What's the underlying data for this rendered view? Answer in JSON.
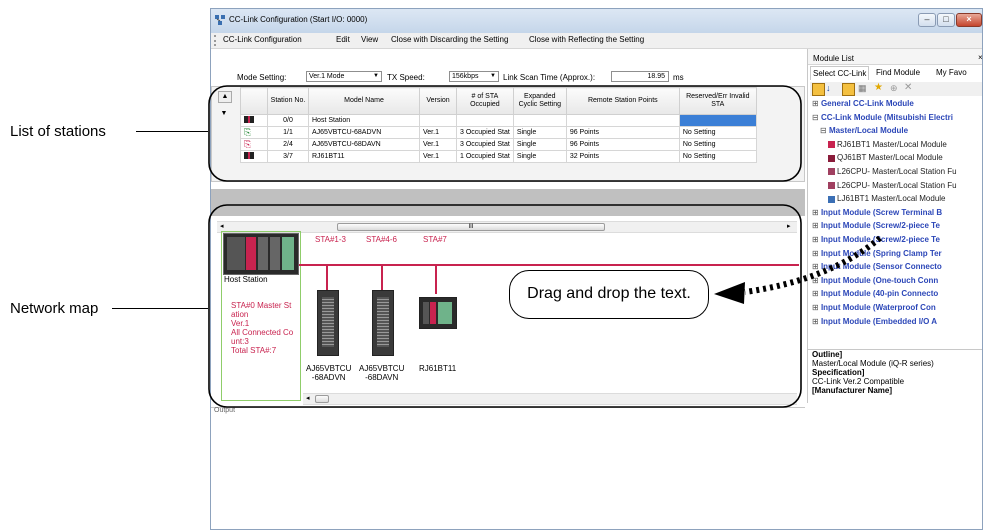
{
  "window": {
    "title": "CC-Link Configuration (Start I/O: 0000)",
    "menu": [
      "CC-Link Configuration",
      "Edit",
      "View",
      "Close with Discarding the Setting",
      "Close with Reflecting the Setting"
    ]
  },
  "settings": {
    "mode_label": "Mode Setting:",
    "mode_value": "Ver.1 Mode",
    "tx_label": "TX Speed:",
    "tx_value": "156kbps",
    "scan_label": "Link Scan Time (Approx.):",
    "scan_value": "18.95",
    "scan_unit": "ms"
  },
  "table": {
    "columns": [
      "Station No.",
      "Model Name",
      "Version",
      "# of STA Occupied",
      "Expanded Cyclic Setting",
      "Remote Station Points",
      "Reserved/Err Invalid STA"
    ],
    "rows": [
      {
        "station": "0/0",
        "model": "Host Station",
        "version": "",
        "occupied": "",
        "cyclic": "",
        "points": "",
        "reserved": ""
      },
      {
        "station": "1/1",
        "model": "AJ65VBTCU-68ADVN",
        "version": "Ver.1",
        "occupied": "3 Occupied Stat",
        "cyclic": "Single",
        "points": "96 Points",
        "reserved": "No Setting"
      },
      {
        "station": "2/4",
        "model": "AJ65VBTCU-68DAVN",
        "version": "Ver.1",
        "occupied": "3 Occupied Stat",
        "cyclic": "Single",
        "points": "96 Points",
        "reserved": "No Setting"
      },
      {
        "station": "3/7",
        "model": "RJ61BT11",
        "version": "Ver.1",
        "occupied": "1 Occupied Stat",
        "cyclic": "Single",
        "points": "32 Points",
        "reserved": "No Setting"
      }
    ]
  },
  "network_map": {
    "scroll_marker": "III",
    "sta_labels": [
      "STA#1-3",
      "STA#4-6",
      "STA#7"
    ],
    "host_label": "Host Station",
    "host_info": [
      "STA#0  Master St",
      "ation",
      "Ver.1",
      "All Connected Co",
      "unt:3",
      "Total STA#:7"
    ],
    "modules": [
      "AJ65VBTCU\n-68ADVN",
      "AJ65VBTCU\n-68DAVN",
      "RJ61BT11"
    ]
  },
  "output": {
    "title": "Output"
  },
  "module_list": {
    "title": "Module List",
    "tabs": [
      "Select CC-Link",
      "Find Module",
      "My Favo"
    ],
    "items": [
      {
        "text": "General CC-Link Module",
        "kind": "cat",
        "sign": "⊞"
      },
      {
        "text": "CC-Link Module (Mitsubishi Electri",
        "kind": "cat",
        "sign": "⊟"
      },
      {
        "text": "Master/Local Module",
        "kind": "cat2",
        "sign": "⊟"
      },
      {
        "text": "RJ61BT1 Master/Local Module",
        "kind": "sub"
      },
      {
        "text": "QJ61BT  Master/Local Module",
        "kind": "sub"
      },
      {
        "text": "L26CPU- Master/Local Station Fu",
        "kind": "sub"
      },
      {
        "text": "L26CPU- Master/Local Station Fu",
        "kind": "sub"
      },
      {
        "text": "LJ61BT1 Master/Local Module",
        "kind": "sub"
      },
      {
        "text": "Input Module (Screw Terminal B",
        "kind": "cat3",
        "sign": "⊞"
      },
      {
        "text": "Input Module (Screw/2-piece Te",
        "kind": "cat3",
        "sign": "⊞"
      },
      {
        "text": "Input Module (Screw/2-piece Te",
        "kind": "cat3",
        "sign": "⊞"
      },
      {
        "text": "Input Module (Spring Clamp Ter",
        "kind": "cat3",
        "sign": "⊞"
      },
      {
        "text": "Input Module (Sensor Connecto",
        "kind": "cat3",
        "sign": "⊞"
      },
      {
        "text": "Input Module (One-touch Conn",
        "kind": "cat3",
        "sign": "⊞"
      },
      {
        "text": "Input Module (40-pin Connecto",
        "kind": "cat3",
        "sign": "⊞"
      },
      {
        "text": "Input Module (Waterproof Con",
        "kind": "cat3",
        "sign": "⊞"
      },
      {
        "text": "Input Module (Embedded I/O A",
        "kind": "cat3",
        "sign": "⊞"
      }
    ],
    "info": [
      "Outline]",
      "Master/Local Module (iQ-R series)",
      "Specification]",
      "CC-Link Ver.2 Compatible",
      "[Manufacturer Name]"
    ]
  },
  "callouts": {
    "list_of_stations": "List of stations",
    "network_map": "Network map",
    "drag_drop": "Drag and drop the text."
  },
  "colors": {
    "accent": "#c8234f",
    "highlight": "#3b7fd6",
    "category": "#2c47b8"
  }
}
